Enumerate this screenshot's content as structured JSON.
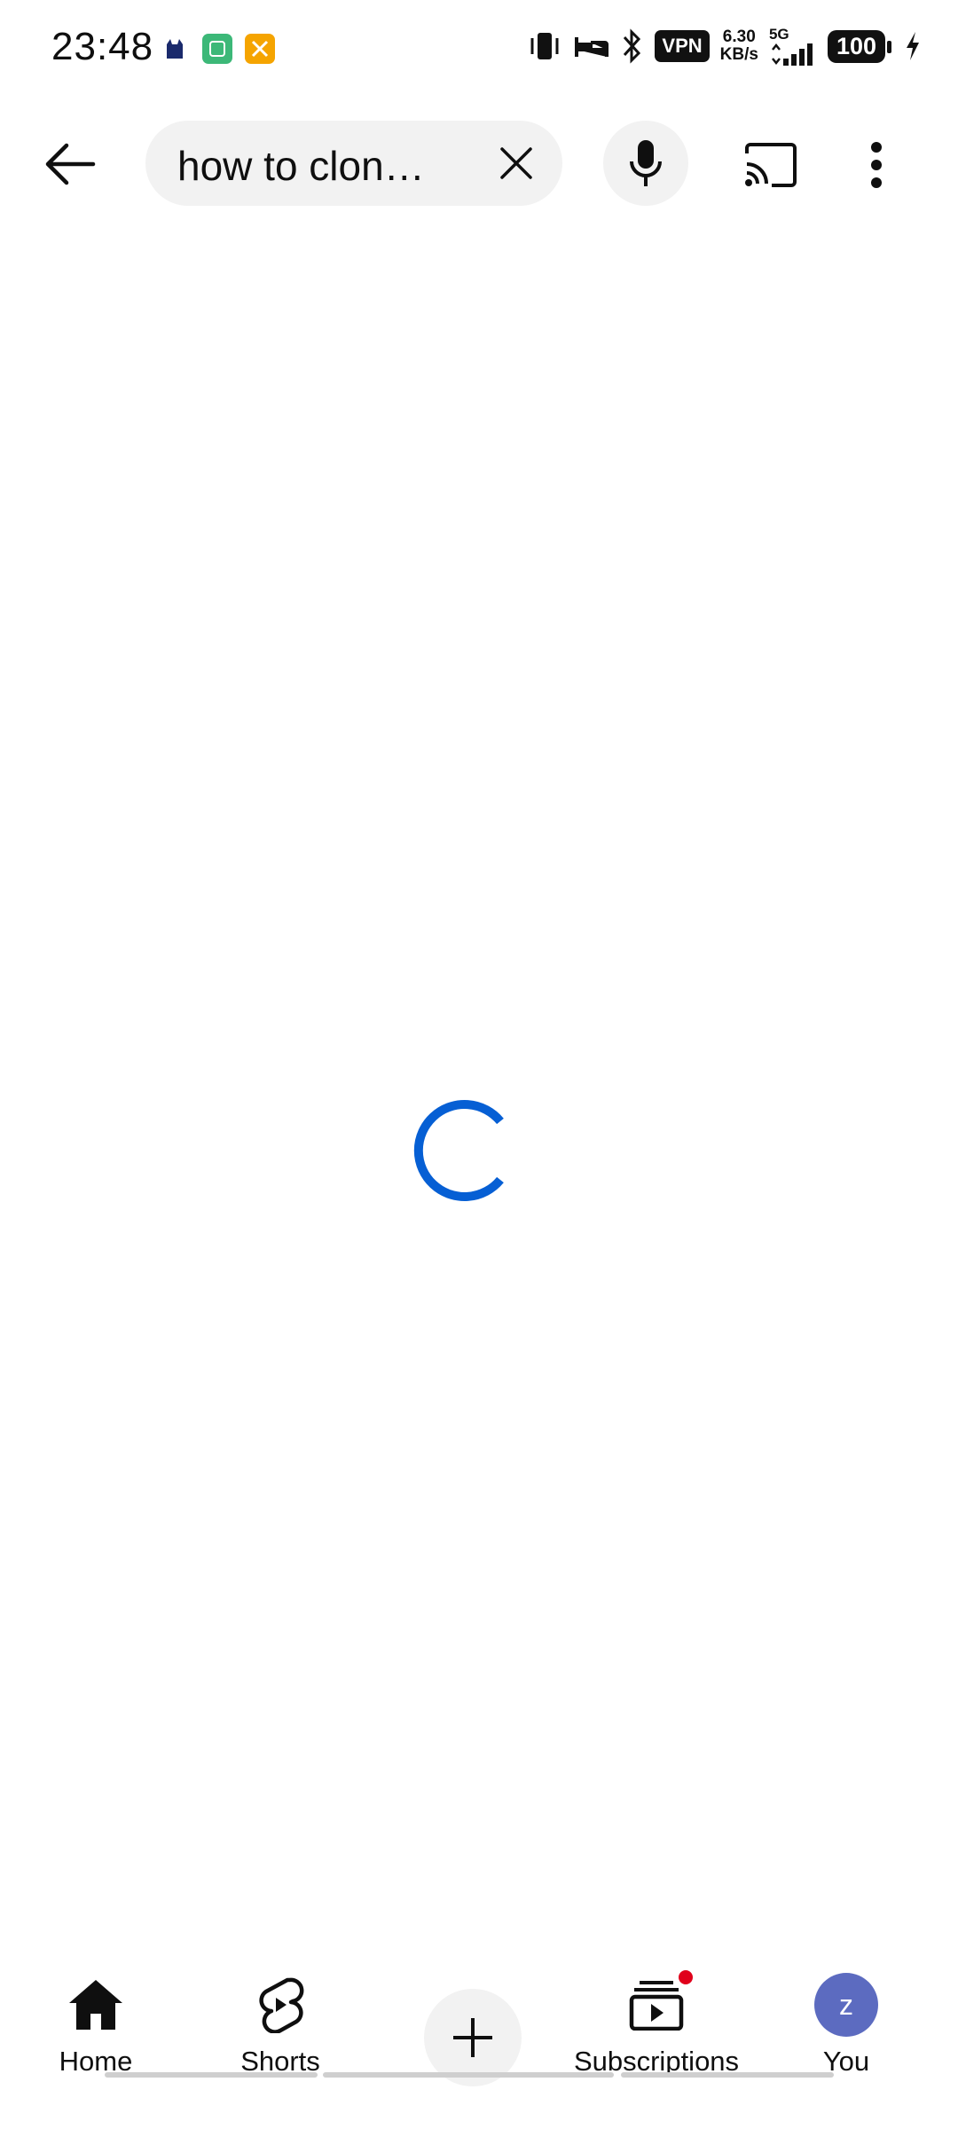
{
  "status_bar": {
    "time": "23:48",
    "vpn": "VPN",
    "net_speed_value": "6.30",
    "net_speed_unit": "KB/s",
    "network": "5G",
    "battery": "100"
  },
  "top_bar": {
    "search_query": "how to clon…"
  },
  "bottom_nav": {
    "home": "Home",
    "shorts": "Shorts",
    "subscriptions": "Subscriptions",
    "you": "You",
    "avatar_letter": "z"
  },
  "colors": {
    "spinner": "#065fd4",
    "notification_dot": "#e0001b",
    "avatar_bg": "#5c6bc0"
  }
}
